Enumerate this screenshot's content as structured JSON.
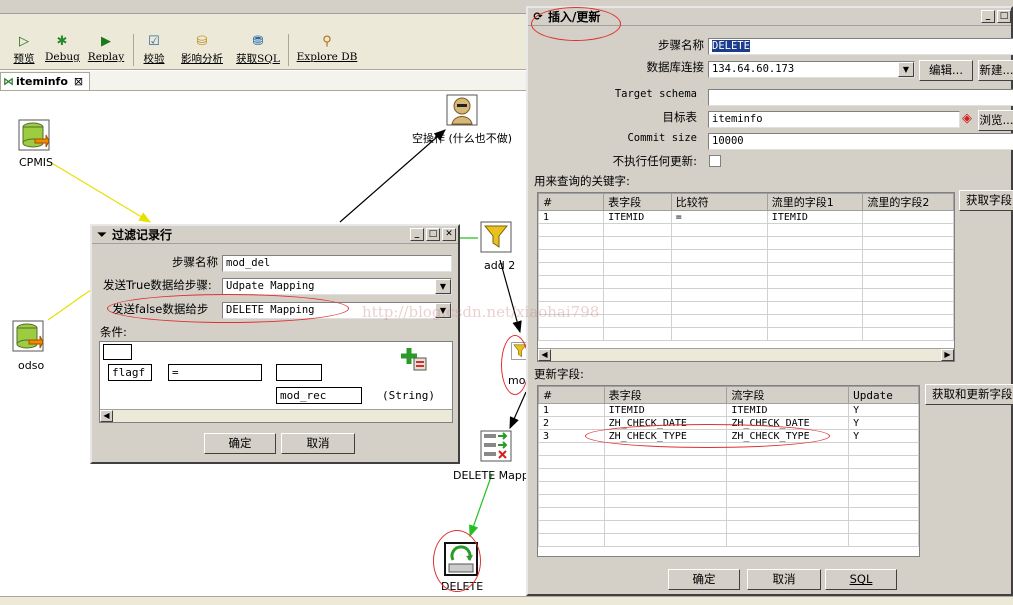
{
  "colors": {
    "accent_red": "#e03030",
    "hop_yellow": "#e8e000",
    "hop_black": "#000000",
    "hop_green": "#22c022",
    "tab_icon_green": "#2a7a2a"
  },
  "toolbar": {
    "items": [
      {
        "label": "预览",
        "icon": "preview-icon"
      },
      {
        "label": "Debug",
        "icon": "bug-icon"
      },
      {
        "label": "Replay",
        "icon": "replay-icon"
      },
      {
        "label": "校验",
        "icon": "check-icon"
      },
      {
        "label": "影响分析",
        "icon": "impact-icon"
      },
      {
        "label": "获取SQL",
        "icon": "sql-icon"
      },
      {
        "label": "Explore DB",
        "icon": "explore-db-icon"
      }
    ]
  },
  "tab": {
    "label": "iteminfo",
    "close": "⊠"
  },
  "canvas": {
    "nodes": {
      "cpmis": "CPMIS",
      "odso": "odso",
      "dummy": "空操作 (什么也不做)",
      "add2": "add 2",
      "mod": "mod",
      "delete_mapping": "DELETE Mapp",
      "delete": "DELETE"
    }
  },
  "filter_dialog": {
    "title": "过滤记录行",
    "step_name_label": "步骤名称",
    "step_name_value": "mod_del",
    "true_label": "发送True数据给步骤:",
    "true_value": "Udpate Mapping",
    "false_label": "发送false数据给步",
    "false_value": "DELETE Mapping",
    "condition_label": "条件:",
    "cond_field": "flagf",
    "cond_op": "=",
    "cond_value": "mod_rec",
    "cond_type": "(String)",
    "ok": "确定",
    "cancel": "取消"
  },
  "insert_dialog": {
    "title": "插入/更新",
    "step_name_label": "步骤名称",
    "step_name_value": "DELETE",
    "db_label": "数据库连接",
    "db_value": "134.64.60.173",
    "edit": "编辑...",
    "new": "新建...",
    "schema_label": "Target schema",
    "schema_value": "",
    "table_label": "目标表",
    "table_value": "iteminfo",
    "browse": "浏览...",
    "commit_label": "Commit size",
    "commit_value": "10000",
    "noupdate_label": "不执行任何更新:",
    "keys_label": "用来查询的关键字:",
    "keys_headers": [
      "#",
      "表字段",
      "比较符",
      "流里的字段1",
      "流里的字段2"
    ],
    "keys_rows": [
      [
        "1",
        "ITEMID",
        "=",
        "ITEMID",
        ""
      ]
    ],
    "get_fields": "获取字段",
    "update_label": "更新字段:",
    "update_headers": [
      "#",
      "表字段",
      "流字段",
      "Update"
    ],
    "update_rows": [
      [
        "1",
        "ITEMID",
        "ITEMID",
        "Y"
      ],
      [
        "2",
        "ZH_CHECK_DATE",
        "ZH_CHECK_DATE",
        "Y"
      ],
      [
        "3",
        "ZH_CHECK_TYPE",
        "ZH_CHECK_TYPE",
        "Y"
      ]
    ],
    "get_update_fields": "获取和更新字段",
    "ok": "确定",
    "cancel": "取消",
    "sql": "SQL"
  },
  "watermark": "http://blog.csdn.net/xiaohai798"
}
